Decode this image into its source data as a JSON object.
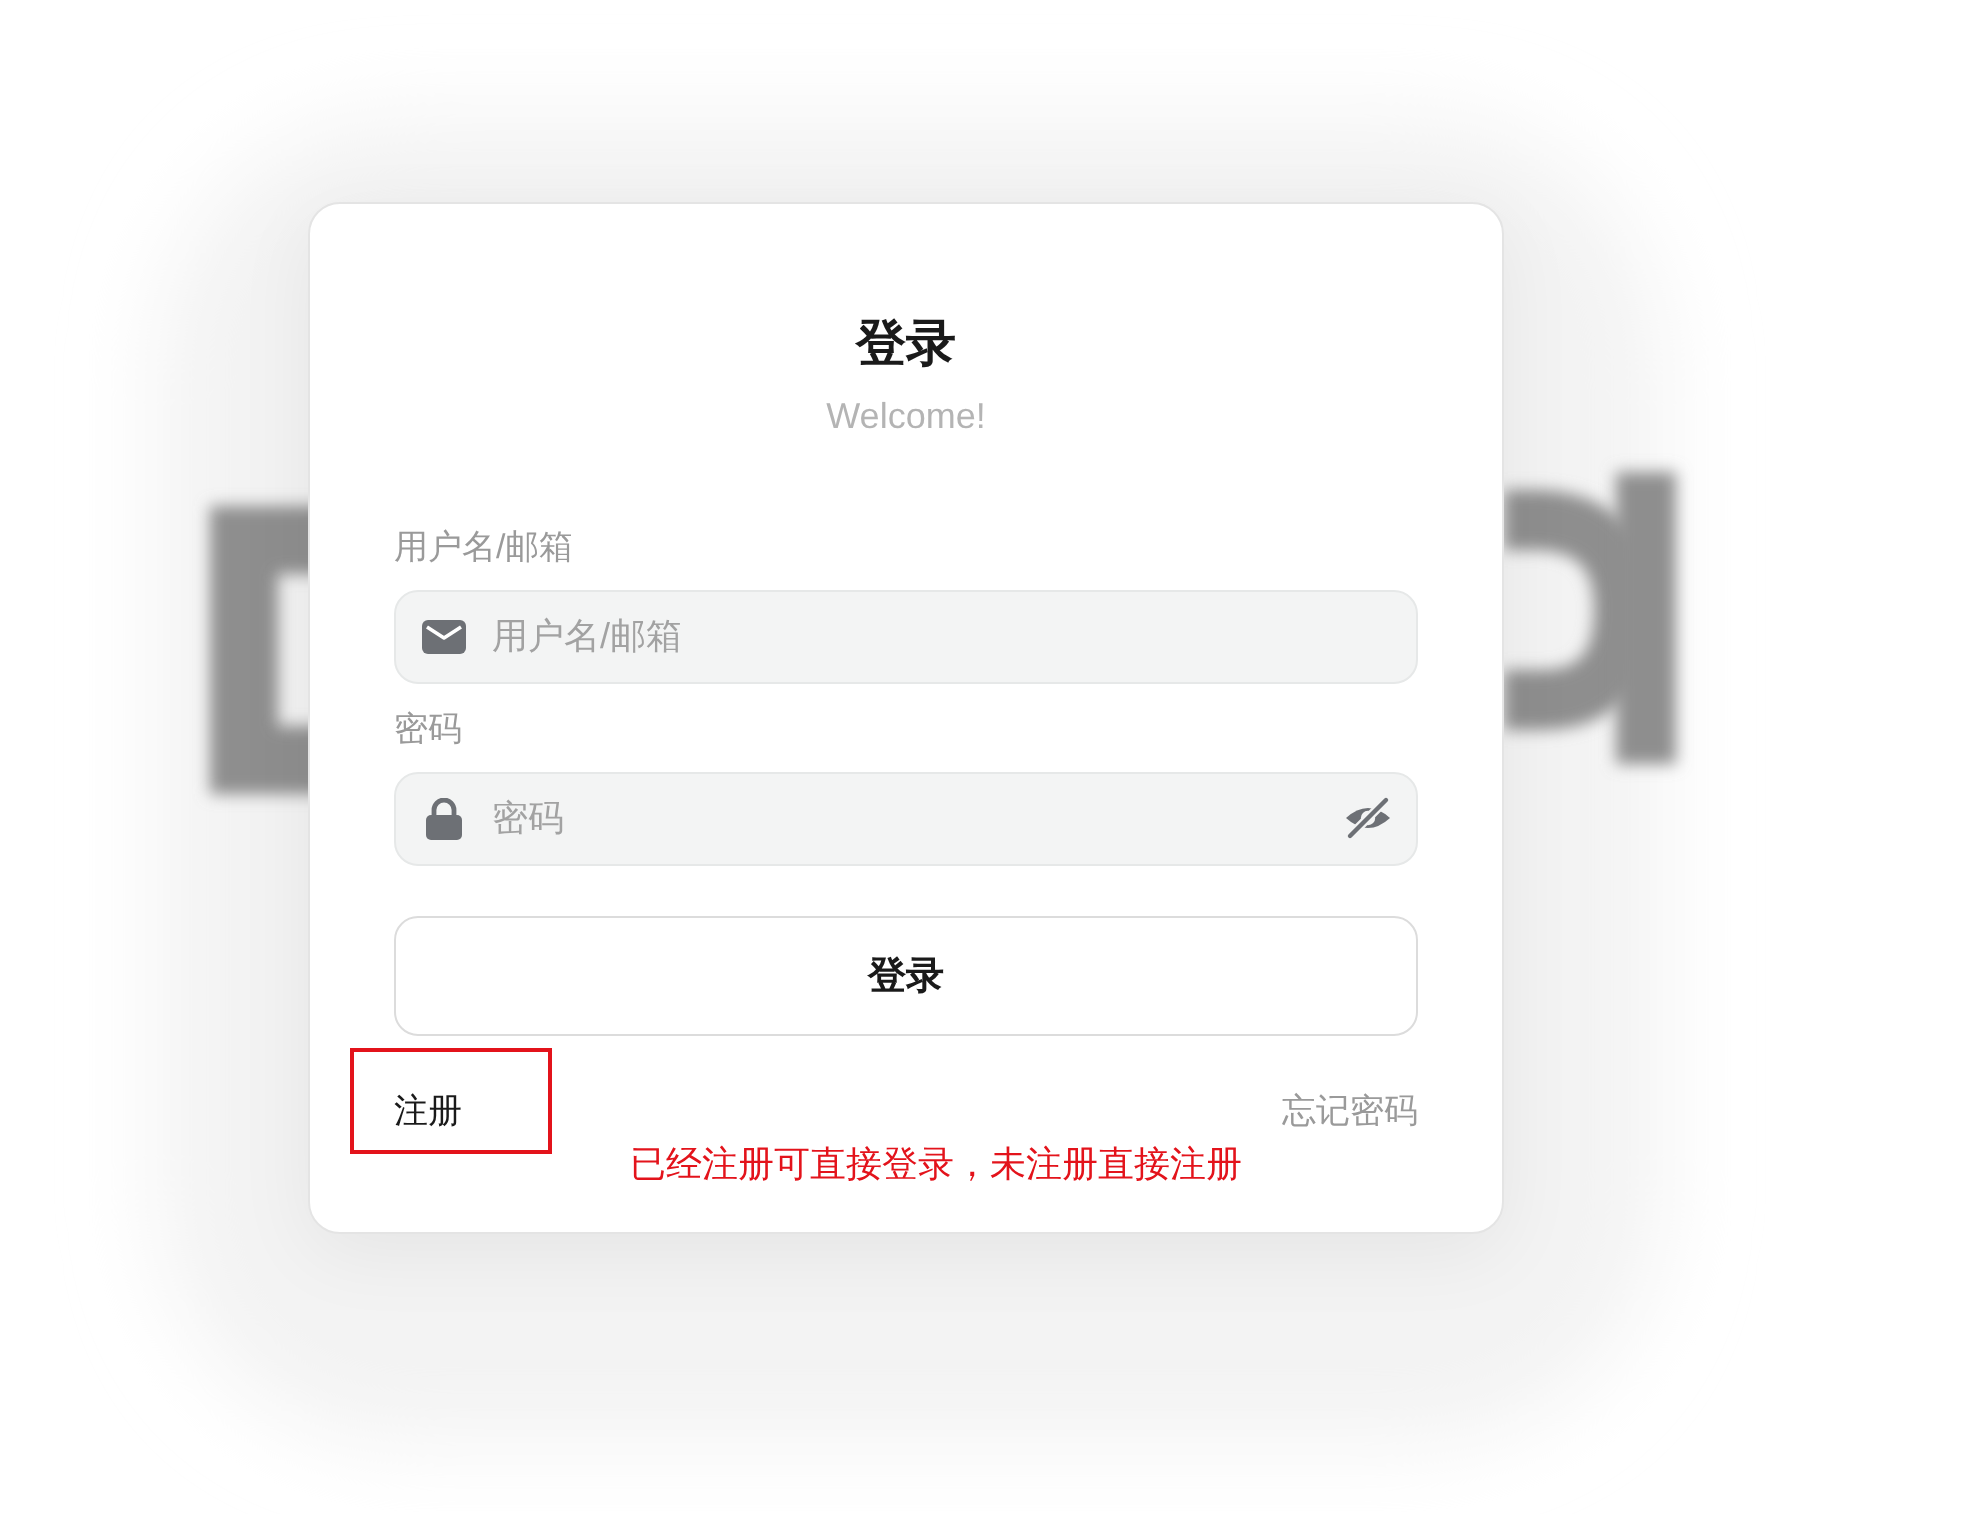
{
  "card": {
    "title": "登录",
    "subtitle": "Welcome!"
  },
  "fields": [
    {
      "kind": "email",
      "label": "用户名/邮箱",
      "placeholder": "用户名/邮箱"
    },
    {
      "kind": "password",
      "label": "密码",
      "placeholder": "密码",
      "password_visible": false
    }
  ],
  "submit_button": "登录",
  "links": [
    {
      "kind": "register",
      "text": "注册",
      "highlighted": true
    },
    {
      "kind": "forgot",
      "text": "忘记密码",
      "highlighted": false
    }
  ],
  "annotation": {
    "note": "已经注册可直接登录，未注册直接注册"
  }
}
